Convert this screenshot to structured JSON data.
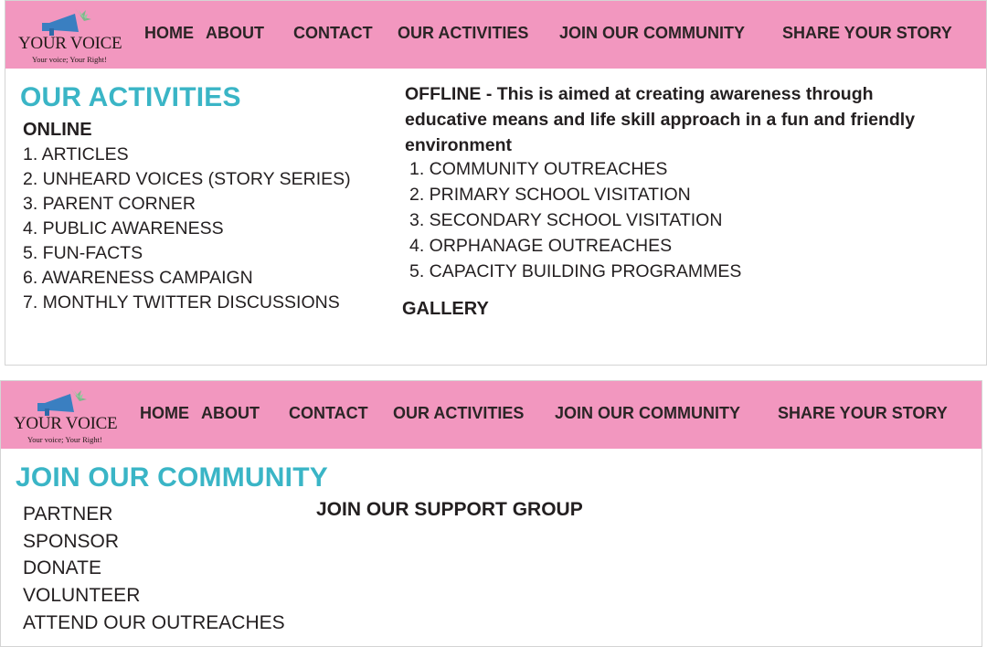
{
  "brand": {
    "name": "YOUR VOICE",
    "tagline": "Your voice; Your Right!",
    "logo_icon": "megaphone-icon",
    "colors": {
      "nav": "#f297bf",
      "heading": "#3ab5c6",
      "megaphone": "#3a7fc1",
      "leaf": "#7fb78c"
    }
  },
  "nav": {
    "items": [
      "HOME",
      "ABOUT",
      "CONTACT",
      "OUR ACTIVITIES",
      "JOIN OUR COMMUNITY",
      "SHARE YOUR STORY"
    ]
  },
  "activities": {
    "title": "OUR ACTIVITIES",
    "online_label": "ONLINE",
    "online": [
      "1. ARTICLES",
      "2. UNHEARD VOICES (STORY SERIES)",
      "3. PARENT CORNER",
      "4. PUBLIC AWARENESS",
      "5. FUN-FACTS",
      "6. AWARENESS CAMPAIGN",
      "7. MONTHLY TWITTER DISCUSSIONS"
    ],
    "offline_intro": "OFFLINE - This is aimed at creating awareness through educative means and life skill approach in a fun and friendly environment",
    "offline": [
      "1. COMMUNITY OUTREACHES",
      "2. PRIMARY SCHOOL VISITATION",
      "3. SECONDARY SCHOOL VISITATION",
      "4. ORPHANAGE OUTREACHES",
      "5. CAPACITY BUILDING PROGRAMMES"
    ],
    "gallery": "GALLERY"
  },
  "community": {
    "title": "JOIN OUR COMMUNITY",
    "items": [
      "PARTNER",
      "SPONSOR",
      "DONATE",
      "VOLUNTEER",
      "ATTEND OUR OUTREACHES"
    ],
    "support_group": "JOIN OUR SUPPORT GROUP"
  }
}
